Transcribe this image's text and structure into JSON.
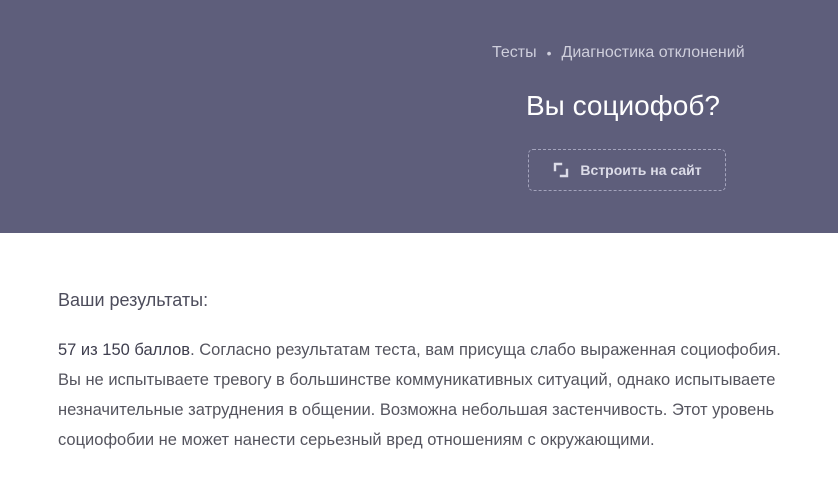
{
  "header": {
    "breadcrumbs": [
      "Тесты",
      "Диагностика отклонений"
    ],
    "separator": "•",
    "title": "Вы социофоб?",
    "embed_label": "Встроить на сайт",
    "embed_icon": "embed-icon"
  },
  "results": {
    "heading": "Ваши результаты:",
    "score": "57 из 150 баллов",
    "description": ". Согласно результатам теста, вам присуща слабо выраженная социофобия. Вы не испытываете тревогу в большинстве коммуникативных ситуаций, однако испытываете незначительные затруднения в общении. Возможна небольшая застенчивость. Этот уровень социофобии не может нанести серьезный вред отношениям с окружающими."
  },
  "colors": {
    "header_bg": "#5e5e7b",
    "title": "#ffffff",
    "text": "#55555f"
  }
}
